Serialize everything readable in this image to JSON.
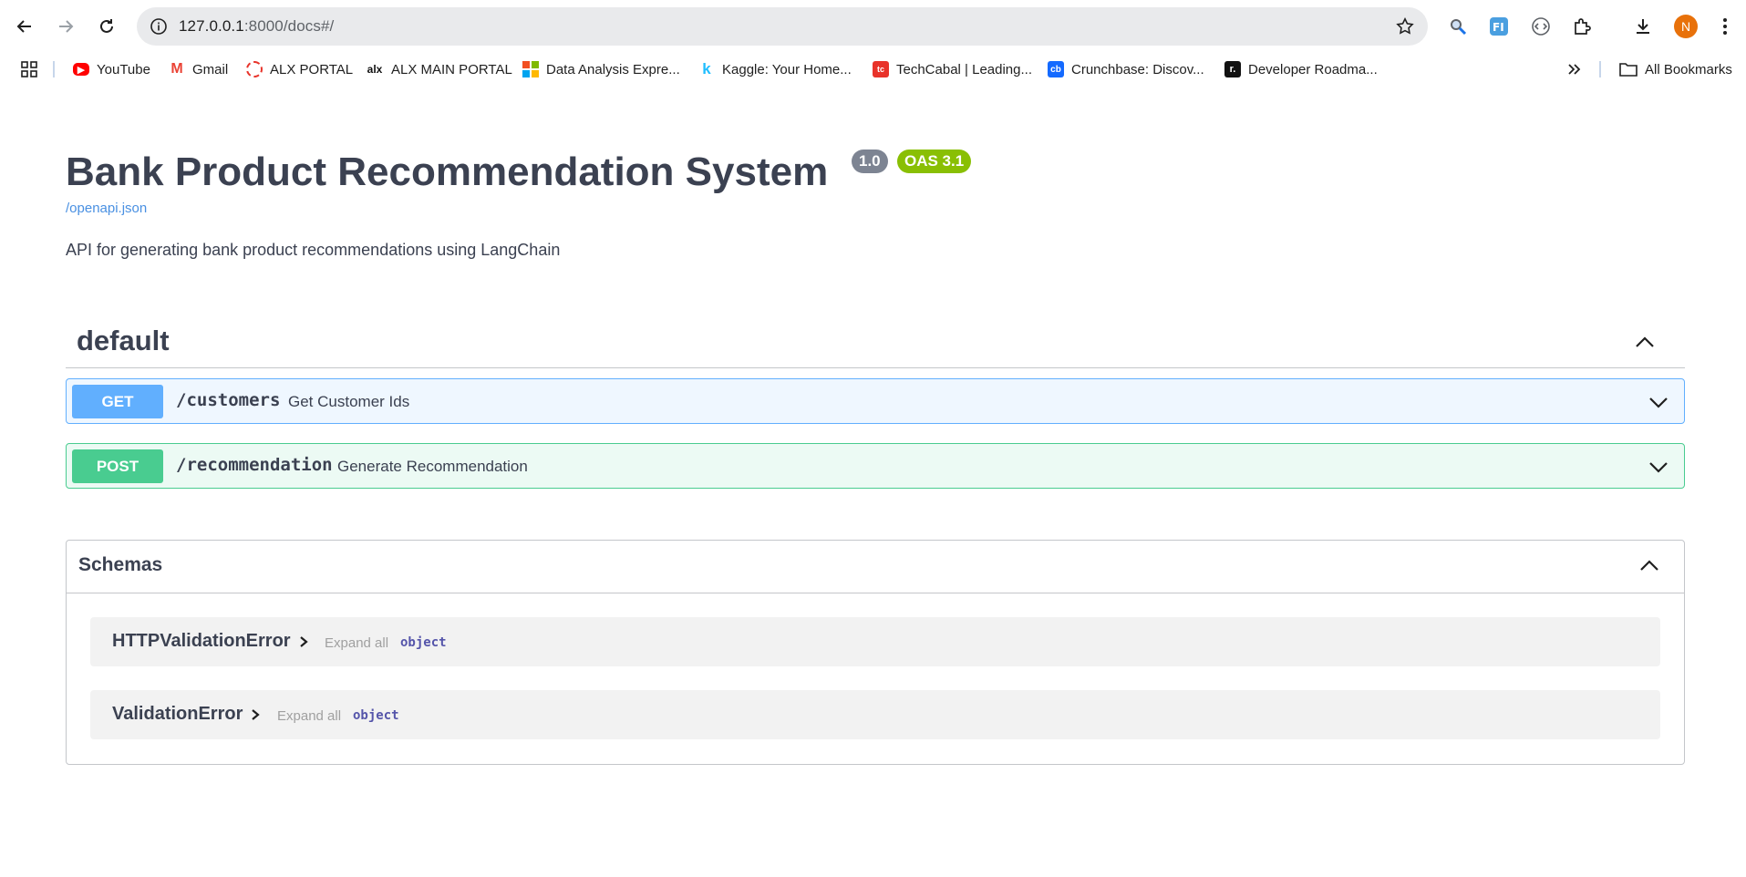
{
  "browser": {
    "url_host": "127.0.0.1",
    "url_path": ":8000/docs#/",
    "avatar_initial": "N",
    "bookmarks": [
      {
        "label": "YouTube",
        "icon": "youtube-icon"
      },
      {
        "label": "Gmail",
        "icon": "gmail-icon"
      },
      {
        "label": "ALX PORTAL",
        "icon": "alx-portal-icon"
      },
      {
        "label": "ALX MAIN PORTAL",
        "icon": "alx-main-icon"
      },
      {
        "label": "Data Analysis Expre...",
        "icon": "microsoft-icon"
      },
      {
        "label": "Kaggle: Your Home...",
        "icon": "kaggle-icon"
      },
      {
        "label": "TechCabal | Leading...",
        "icon": "techcabal-icon"
      },
      {
        "label": "Crunchbase: Discov...",
        "icon": "crunchbase-icon"
      },
      {
        "label": "Developer Roadma...",
        "icon": "roadmap-icon"
      }
    ],
    "all_bookmarks_label": "All Bookmarks"
  },
  "api": {
    "title": "Bank Product Recommendation System",
    "version": "1.0",
    "oas": "OAS 3.1",
    "openapi_link": "/openapi.json",
    "description": "API for generating bank product recommendations using LangChain"
  },
  "tag": {
    "name": "default"
  },
  "operations": [
    {
      "method": "GET",
      "path": "/customers",
      "summary": "Get Customer Ids"
    },
    {
      "method": "POST",
      "path": "/recommendation",
      "summary": "Generate Recommendation"
    }
  ],
  "schemas": {
    "title": "Schemas",
    "expand_label": "Expand all",
    "models": [
      {
        "name": "HTTPValidationError",
        "type": "object"
      },
      {
        "name": "ValidationError",
        "type": "object"
      }
    ]
  },
  "colors": {
    "get": "#61affe",
    "post": "#49cc90",
    "oas_badge": "#89bf04",
    "version_badge": "#7d8492",
    "link": "#4990e2"
  }
}
